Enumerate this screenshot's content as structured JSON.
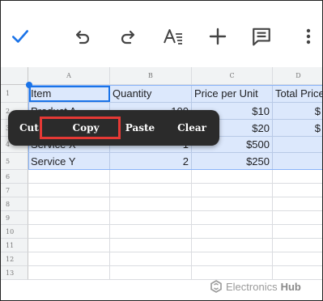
{
  "toolbar": {
    "icons": [
      "check-icon",
      "undo-icon",
      "redo-icon",
      "text-format-icon",
      "insert-icon",
      "comment-icon",
      "more-vert-icon"
    ],
    "accent_color": "#1a73e8",
    "icon_color": "#444444"
  },
  "sheet": {
    "columns": [
      "A",
      "B",
      "C",
      "D"
    ],
    "rows": [
      "1",
      "2",
      "3",
      "4",
      "5",
      "6",
      "7",
      "8",
      "9",
      "10",
      "11",
      "12",
      "13"
    ],
    "cells": {
      "A1": "Item",
      "B1": "Quantity",
      "C1": "Price per Unit",
      "D1": "Total Price",
      "A2": "Product A",
      "B2": "100",
      "C2": "$10",
      "D2": "$",
      "A3": "",
      "B3": "",
      "C3": "$20",
      "D3": "$",
      "A4": "Service X",
      "B4": "1",
      "C4": "$500",
      "D4": "",
      "A5": "Service Y",
      "B5": "2",
      "C5": "$250",
      "D5": ""
    },
    "selection_color": "#dce8fc"
  },
  "context_menu": {
    "items": [
      "Cut",
      "Copy",
      "Paste",
      "Clear"
    ],
    "highlighted": "Copy",
    "highlight_color": "#e53935"
  },
  "watermark": {
    "text_light": "Electronics",
    "text_bold": "Hub"
  }
}
